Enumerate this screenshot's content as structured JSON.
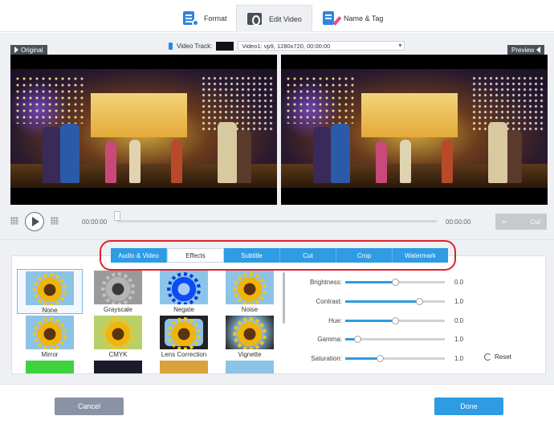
{
  "tabs": [
    {
      "label": "Format",
      "icon": "format-icon"
    },
    {
      "label": "Edit Video",
      "icon": "edit-video-icon",
      "active": true
    },
    {
      "label": "Name & Tag",
      "icon": "name-tag-icon"
    }
  ],
  "video_track": {
    "label": "Video Track:",
    "value": "Video1: vp9, 1280x720, 00:00:00"
  },
  "preview": {
    "original_label": "Original",
    "preview_label": "Preview"
  },
  "timeline": {
    "start_time": "00:00:00",
    "end_time": "00:00:00",
    "progress": 0,
    "cut_label": "Cut"
  },
  "edit_tabs": [
    "Audio & Video",
    "Effects",
    "Subtitle",
    "Cut",
    "Crop",
    "Watermark"
  ],
  "active_edit_tab": "Effects",
  "effects": [
    "None",
    "Grayscale",
    "Negate",
    "Noise",
    "Mirror",
    "CMYK",
    "Lens Correction",
    "Vignette"
  ],
  "selected_effect": "None",
  "adjustments": [
    {
      "label": "Brightness:",
      "value": "0.0",
      "level": 0.5
    },
    {
      "label": "Contrast:",
      "value": "1.0",
      "level": 0.74
    },
    {
      "label": "Hue:",
      "value": "0.0",
      "level": 0.5
    },
    {
      "label": "Gamma:",
      "value": "1.0",
      "level": 0.12
    },
    {
      "label": "Saturation:",
      "value": "1.0",
      "level": 0.35
    }
  ],
  "reset_label": "Reset",
  "buttons": {
    "cancel": "Cancel",
    "done": "Done"
  },
  "colors": {
    "accent": "#2e9be3",
    "highlight_ring": "#e0222c"
  }
}
